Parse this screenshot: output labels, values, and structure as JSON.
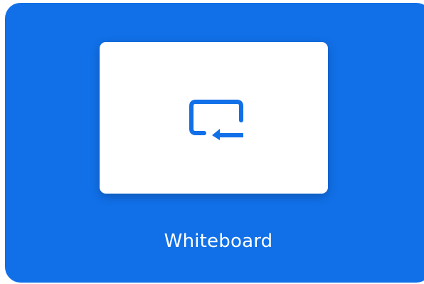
{
  "tile": {
    "label": "Whiteboard",
    "icon": "whiteboard-icon"
  },
  "colors": {
    "tile_background": "#1170E8",
    "preview_background": "#FFFFFF",
    "icon_color": "#1170E8",
    "label_color": "#FFFFFF"
  }
}
